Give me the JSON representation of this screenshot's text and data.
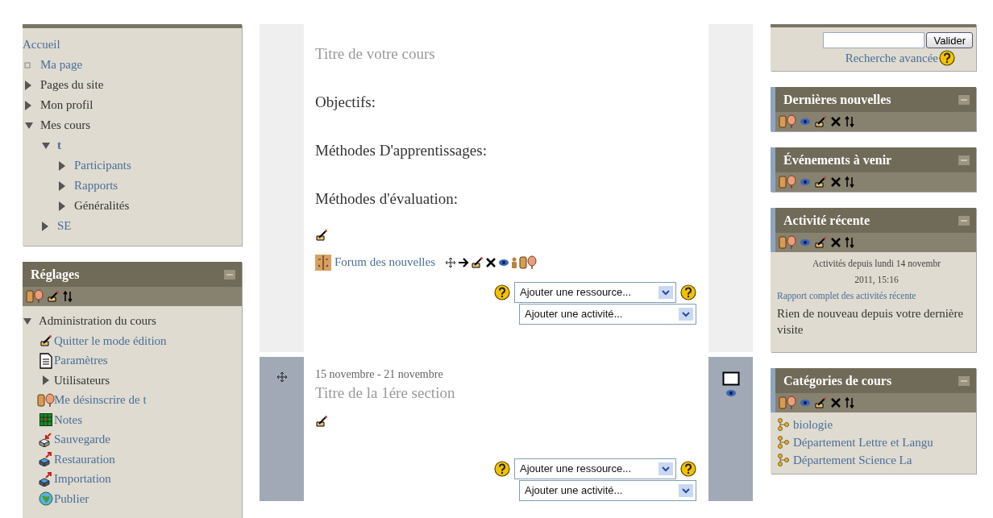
{
  "navigation": {
    "items": [
      {
        "label": "Accueil",
        "kind": "root",
        "link": true,
        "current": false
      },
      {
        "label": "Ma page",
        "kind": "leaf",
        "link": true,
        "current": false
      },
      {
        "label": "Pages du site",
        "kind": "branch",
        "expanded": false,
        "link": false,
        "current": false
      },
      {
        "label": "Mon profil",
        "kind": "branch",
        "expanded": false,
        "link": false,
        "current": false
      },
      {
        "label": "Mes cours",
        "kind": "branch",
        "expanded": true,
        "link": false,
        "current": false,
        "children": [
          {
            "label": "t",
            "kind": "branch",
            "expanded": true,
            "link": true,
            "current": true,
            "children": [
              {
                "label": "Participants",
                "kind": "branch",
                "expanded": false,
                "link": true,
                "current": false
              },
              {
                "label": "Rapports",
                "kind": "branch",
                "expanded": false,
                "link": true,
                "current": false
              },
              {
                "label": "Généralités",
                "kind": "branch",
                "expanded": false,
                "link": false,
                "current": false
              }
            ]
          },
          {
            "label": "SE",
            "kind": "branch",
            "expanded": false,
            "link": true,
            "current": false
          }
        ]
      }
    ]
  },
  "settings": {
    "title": "Réglages",
    "section": {
      "label": "Administration du cours",
      "expanded": true
    },
    "items": [
      {
        "label": "Quitter le mode édition",
        "kind": "edit"
      },
      {
        "label": "Paramètres",
        "kind": "document"
      },
      {
        "label": "Utilisateurs",
        "kind": "branch",
        "expanded": false
      },
      {
        "label": "Me désinscrire de t",
        "kind": "user"
      },
      {
        "label": "Notes",
        "kind": "grades"
      },
      {
        "label": "Sauvegarde",
        "kind": "backup"
      },
      {
        "label": "Restauration",
        "kind": "restore"
      },
      {
        "label": "Importation",
        "kind": "import"
      },
      {
        "label": "Publier",
        "kind": "publish"
      }
    ]
  },
  "sections": [
    {
      "current": false,
      "title": "Titre de votre cours",
      "headings": [
        "Objectifs:",
        "Méthodes D'apprentissages:",
        "Méthodes d'évaluation:"
      ],
      "activities": [
        {
          "label": "Forum des nouvelles"
        }
      ],
      "resource_select": "Ajouter une ressource...",
      "activity_select": "Ajouter une activité..."
    },
    {
      "current": true,
      "dates": "15 novembre - 21 novembre",
      "title": "Titre de la 1ére section",
      "resource_select": "Ajouter une ressource...",
      "activity_select": "Ajouter une activité..."
    }
  ],
  "search": {
    "button": "Valider",
    "link": "Recherche avancée"
  },
  "blocks": [
    {
      "kind": "plain",
      "title": "Dernières nouvelles"
    },
    {
      "kind": "plain",
      "title": "Événements à venir"
    },
    {
      "kind": "recent",
      "title": "Activité récente",
      "since": [
        "Activités depuis lundi 14 novembr",
        "2011, 15:16"
      ],
      "link": "Rapport complet des activités récente",
      "message": "Rien de nouveau depuis votre dernière visite"
    },
    {
      "kind": "categories",
      "title": "Catégories de cours",
      "items": [
        "biologie",
        "Département Lettre et Langu",
        "Département Science La"
      ]
    }
  ]
}
